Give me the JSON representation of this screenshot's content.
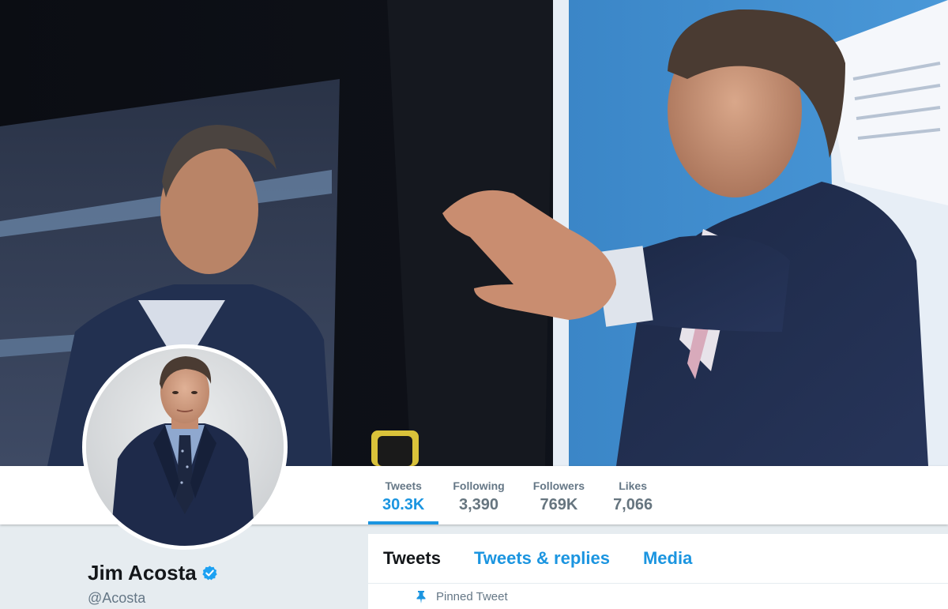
{
  "profile": {
    "name": "Jim Acosta",
    "handle": "@Acosta",
    "verified": true
  },
  "stats": [
    {
      "label": "Tweets",
      "value": "30.3K",
      "active": true
    },
    {
      "label": "Following",
      "value": "3,390",
      "active": false
    },
    {
      "label": "Followers",
      "value": "769K",
      "active": false
    },
    {
      "label": "Likes",
      "value": "7,066",
      "active": false
    }
  ],
  "tabs": [
    {
      "label": "Tweets",
      "active": true
    },
    {
      "label": "Tweets & replies",
      "active": false
    },
    {
      "label": "Media",
      "active": false
    }
  ],
  "pinned": {
    "label": "Pinned Tweet",
    "icon": "pin-icon"
  },
  "colors": {
    "accent": "#1b95e0",
    "page_bg": "#e6ecf0",
    "text_primary": "#14171a",
    "text_secondary": "#657786"
  }
}
